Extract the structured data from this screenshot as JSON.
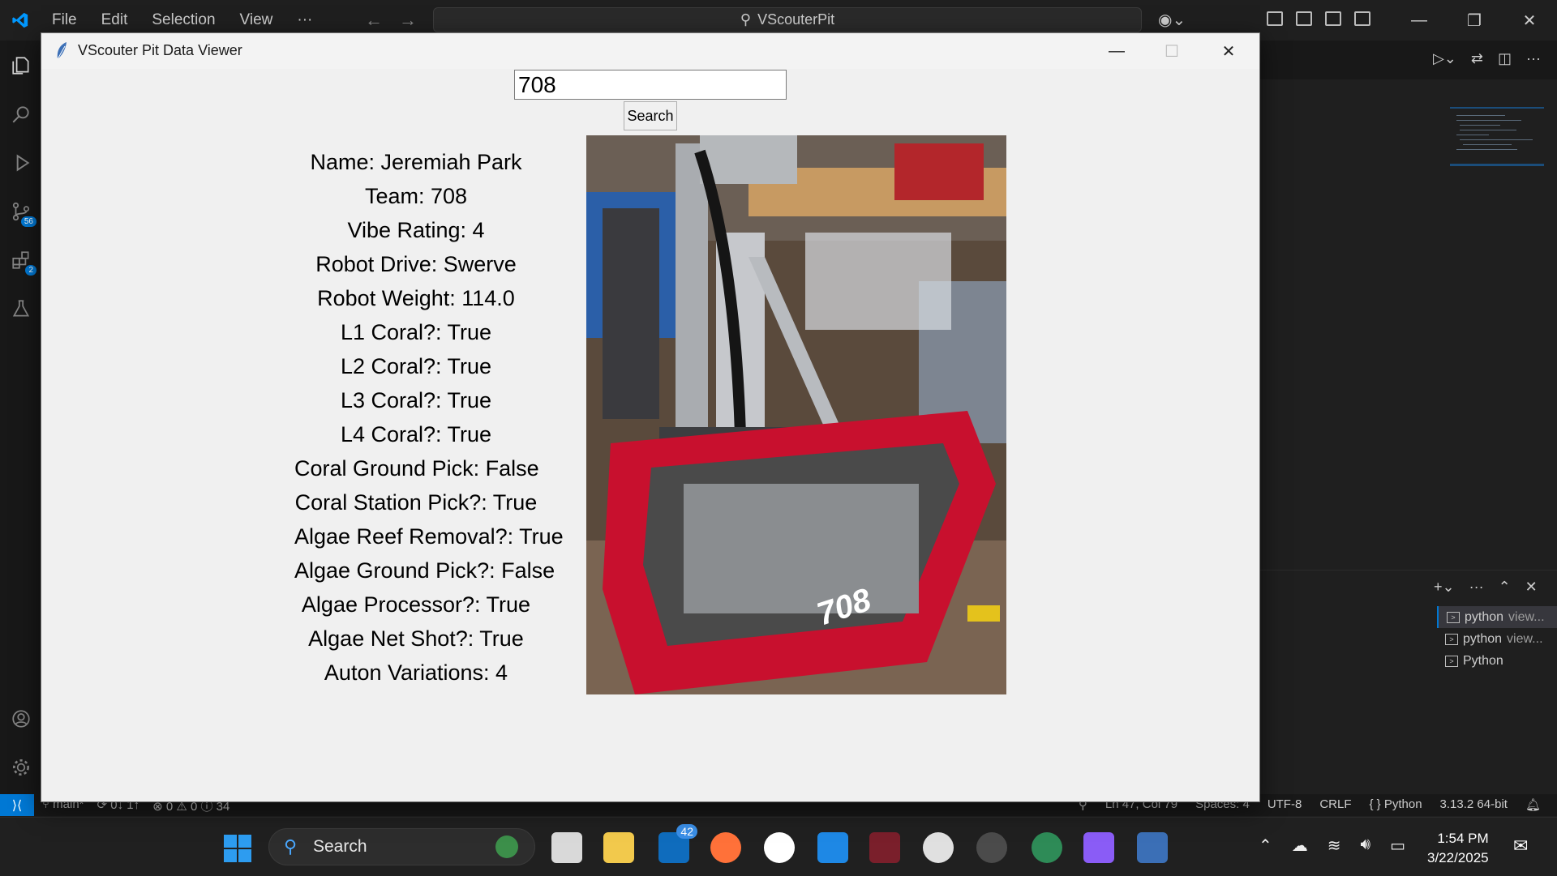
{
  "vscode": {
    "menu": [
      "File",
      "Edit",
      "Selection",
      "View",
      "···"
    ],
    "search_text": "VScouterPit",
    "activity_badges": {
      "source_control": "56",
      "extensions": "2"
    },
    "status": {
      "branch": "main*",
      "sync": "0↓ 1↑",
      "problems": "⊗ 0 ⚠ 0 ⓘ 34",
      "position": "Ln 47, Col 79",
      "spaces": "Spaces: 4",
      "encoding": "UTF-8",
      "eol": "CRLF",
      "language": "{ } Python",
      "interpreter": "3.13.2 64-bit"
    },
    "terminals": [
      {
        "name": "python",
        "sub": "view..."
      },
      {
        "name": "python",
        "sub": "view..."
      },
      {
        "name": "Python",
        "sub": ""
      }
    ]
  },
  "dialog": {
    "title": "VScouter Pit Data Viewer",
    "search_value": "708",
    "search_button": "Search",
    "fields": [
      "Name: Jeremiah Park",
      "Team: 708",
      "Vibe Rating: 4",
      "Robot Drive: Swerve",
      "Robot Weight: 114.0",
      "L1 Coral?: True",
      "L2 Coral?: True",
      "L3 Coral?: True",
      "L4 Coral?: True",
      "Coral Ground Pick: False",
      "Coral Station Pick?: True",
      "Algae Reef Removal?: True",
      "Algae Ground Pick?: False",
      "Algae Processor?: True",
      "Algae Net Shot?: True",
      "Auton Variations: 4"
    ],
    "photo_text": "708"
  },
  "taskbar": {
    "search": "Search",
    "mail_badge": "42",
    "time": "1:54 PM",
    "date": "3/22/2025"
  },
  "colors": {
    "accent": "#0078d4",
    "bumper_red": "#c8102e"
  }
}
